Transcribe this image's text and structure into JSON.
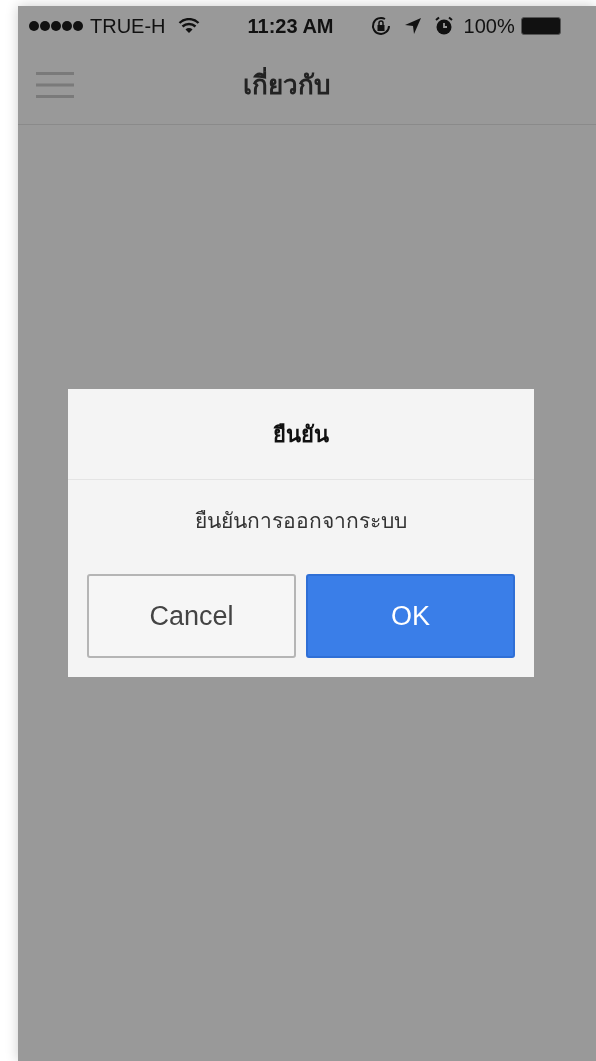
{
  "status_bar": {
    "carrier": "TRUE-H",
    "time": "11:23 AM",
    "battery": "100%"
  },
  "header": {
    "title": "เกี่ยวกับ"
  },
  "dialog": {
    "title": "ยืนยัน",
    "message": "ยืนยันการออกจากระบบ",
    "buttons": [
      {
        "label": "Cancel",
        "kind": "secondary"
      },
      {
        "label": "OK",
        "kind": "primary"
      }
    ]
  }
}
